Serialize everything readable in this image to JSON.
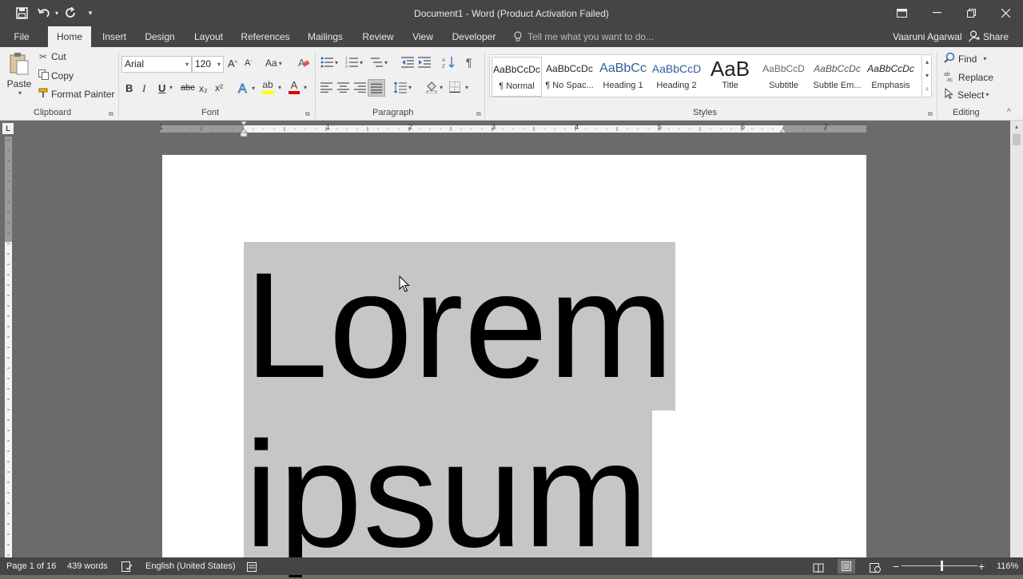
{
  "title_bar": {
    "title": "Document1 - Word (Product Activation Failed)",
    "icons": [
      "save-icon",
      "undo-icon",
      "redo-icon",
      "customize-icon"
    ]
  },
  "tabs": {
    "file": "File",
    "home": "Home",
    "insert": "Insert",
    "design": "Design",
    "layout": "Layout",
    "references": "References",
    "mailings": "Mailings",
    "review": "Review",
    "view": "View",
    "developer": "Developer",
    "tell_me": "Tell me what you want to do...",
    "user": "Vaaruni Agarwal",
    "share": "Share",
    "active": "Home"
  },
  "clipboard": {
    "paste": "Paste",
    "cut": "Cut",
    "copy": "Copy",
    "format_painter": "Format Painter",
    "label": "Clipboard"
  },
  "font": {
    "name": "Arial",
    "size": "120",
    "bold": "B",
    "italic": "I",
    "underline": "U",
    "strike": "abc",
    "subscript": "x₂",
    "superscript": "x²",
    "label": "Font",
    "highlight_color": "#ffff00",
    "font_color": "#e00000"
  },
  "paragraph": {
    "label": "Paragraph",
    "pilcrow": "¶"
  },
  "styles": {
    "label": "Styles",
    "items": [
      {
        "preview": "AaBbCcDc",
        "name": "¶ Normal"
      },
      {
        "preview": "AaBbCcDc",
        "name": "¶ No Spac..."
      },
      {
        "preview": "AaBbCc",
        "name": "Heading 1"
      },
      {
        "preview": "AaBbCcD",
        "name": "Heading 2"
      },
      {
        "preview": "AaB",
        "name": "Title"
      },
      {
        "preview": "AaBbCcD",
        "name": "Subtitle"
      },
      {
        "preview": "AaBbCcDc",
        "name": "Subtle Em..."
      },
      {
        "preview": "AaBbCcDc",
        "name": "Emphasis"
      }
    ]
  },
  "editing": {
    "find": "Find",
    "replace": "Replace",
    "select": "Select",
    "label": "Editing"
  },
  "ruler": {
    "numbers": [
      "1",
      "1",
      "2",
      "3",
      "4",
      "5",
      "6",
      "7"
    ]
  },
  "document": {
    "line1": "Lorem",
    "line2": "ipsum"
  },
  "status": {
    "page": "Page 1 of 16",
    "words": "439 words",
    "language": "English (United States)",
    "zoom": "116%"
  }
}
